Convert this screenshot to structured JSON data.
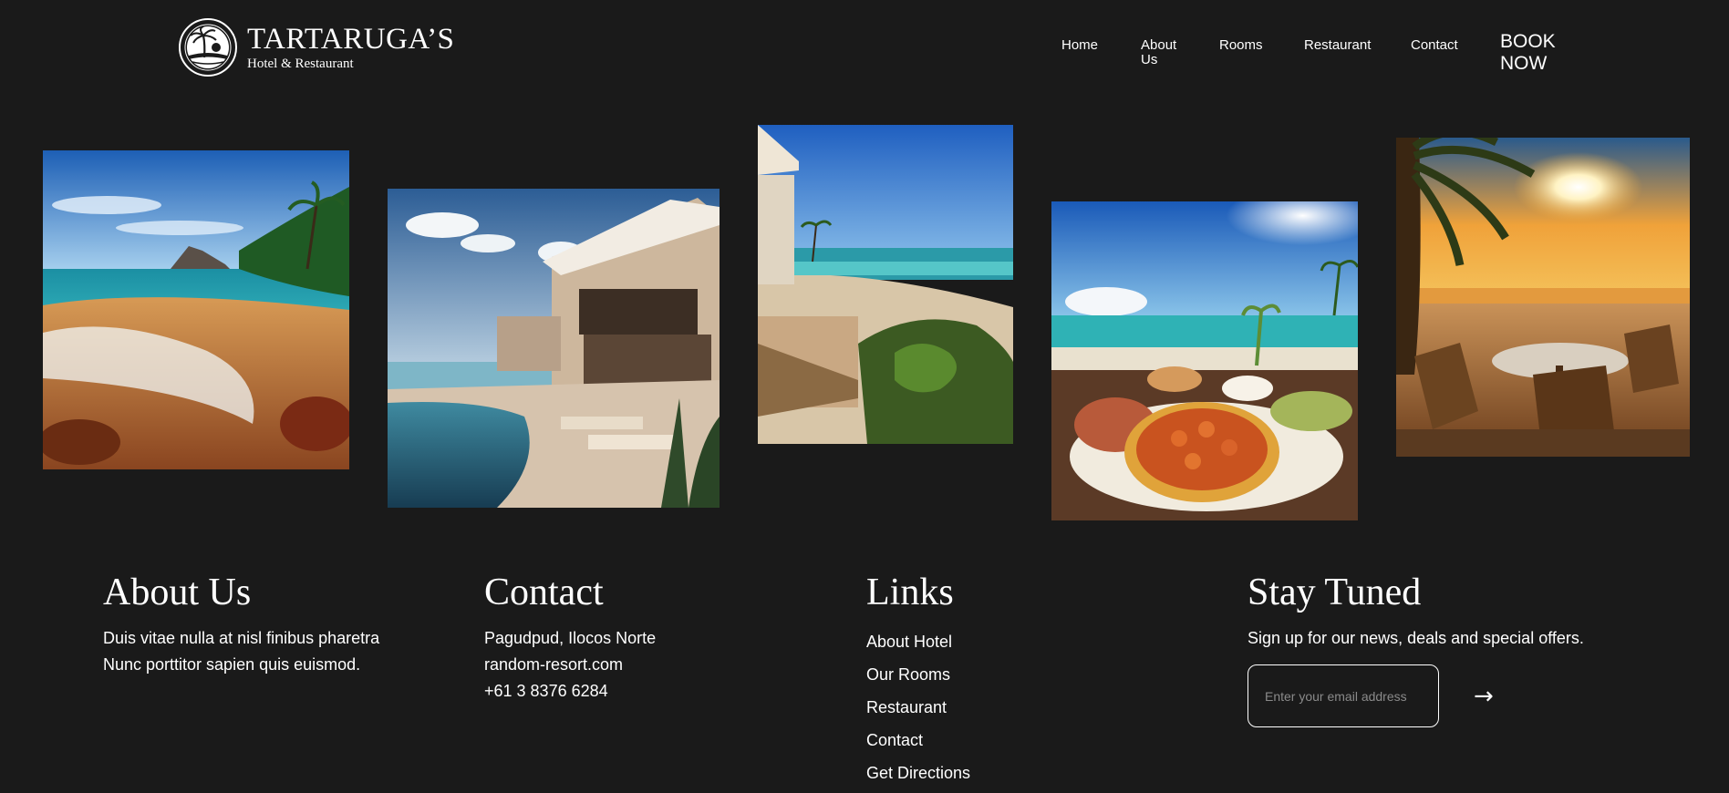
{
  "brand": {
    "name": "TARTARUGA’S",
    "subtitle": "Hotel & Restaurant",
    "emblem_icon": "turtle-palm-emblem-icon"
  },
  "nav": {
    "home": "Home",
    "about": "About Us",
    "rooms": "Rooms",
    "restaurant": "Restaurant",
    "contact": "Contact",
    "book": "BOOK NOW"
  },
  "gallery": [
    {
      "name": "beach-shore-photo"
    },
    {
      "name": "resort-pool-photo"
    },
    {
      "name": "beach-terrace-photo"
    },
    {
      "name": "seafood-table-photo"
    },
    {
      "name": "sunset-dining-photo"
    }
  ],
  "footer": {
    "about": {
      "title": "About Us",
      "line1": "Duis vitae nulla at nisl finibus pharetra",
      "line2": "Nunc porttitor sapien quis euismod."
    },
    "contact": {
      "title": "Contact",
      "address": "Pagudpud, Ilocos Norte",
      "website": "random-resort.com",
      "phone": "+61 3 8376 6284"
    },
    "links": {
      "title": "Links",
      "items": [
        "About Hotel",
        "Our Rooms",
        "Restaurant",
        "Contact",
        "Get Directions"
      ]
    },
    "newsletter": {
      "title": "Stay Tuned",
      "text": "Sign up for our news, deals and special offers.",
      "placeholder": "Enter your email address",
      "submit_symbol": "→",
      "submit_icon": "arrow-right-icon"
    }
  },
  "colors": {
    "background": "#1a1a1a",
    "text": "#ffffff",
    "placeholder": "#8a8a8a"
  }
}
